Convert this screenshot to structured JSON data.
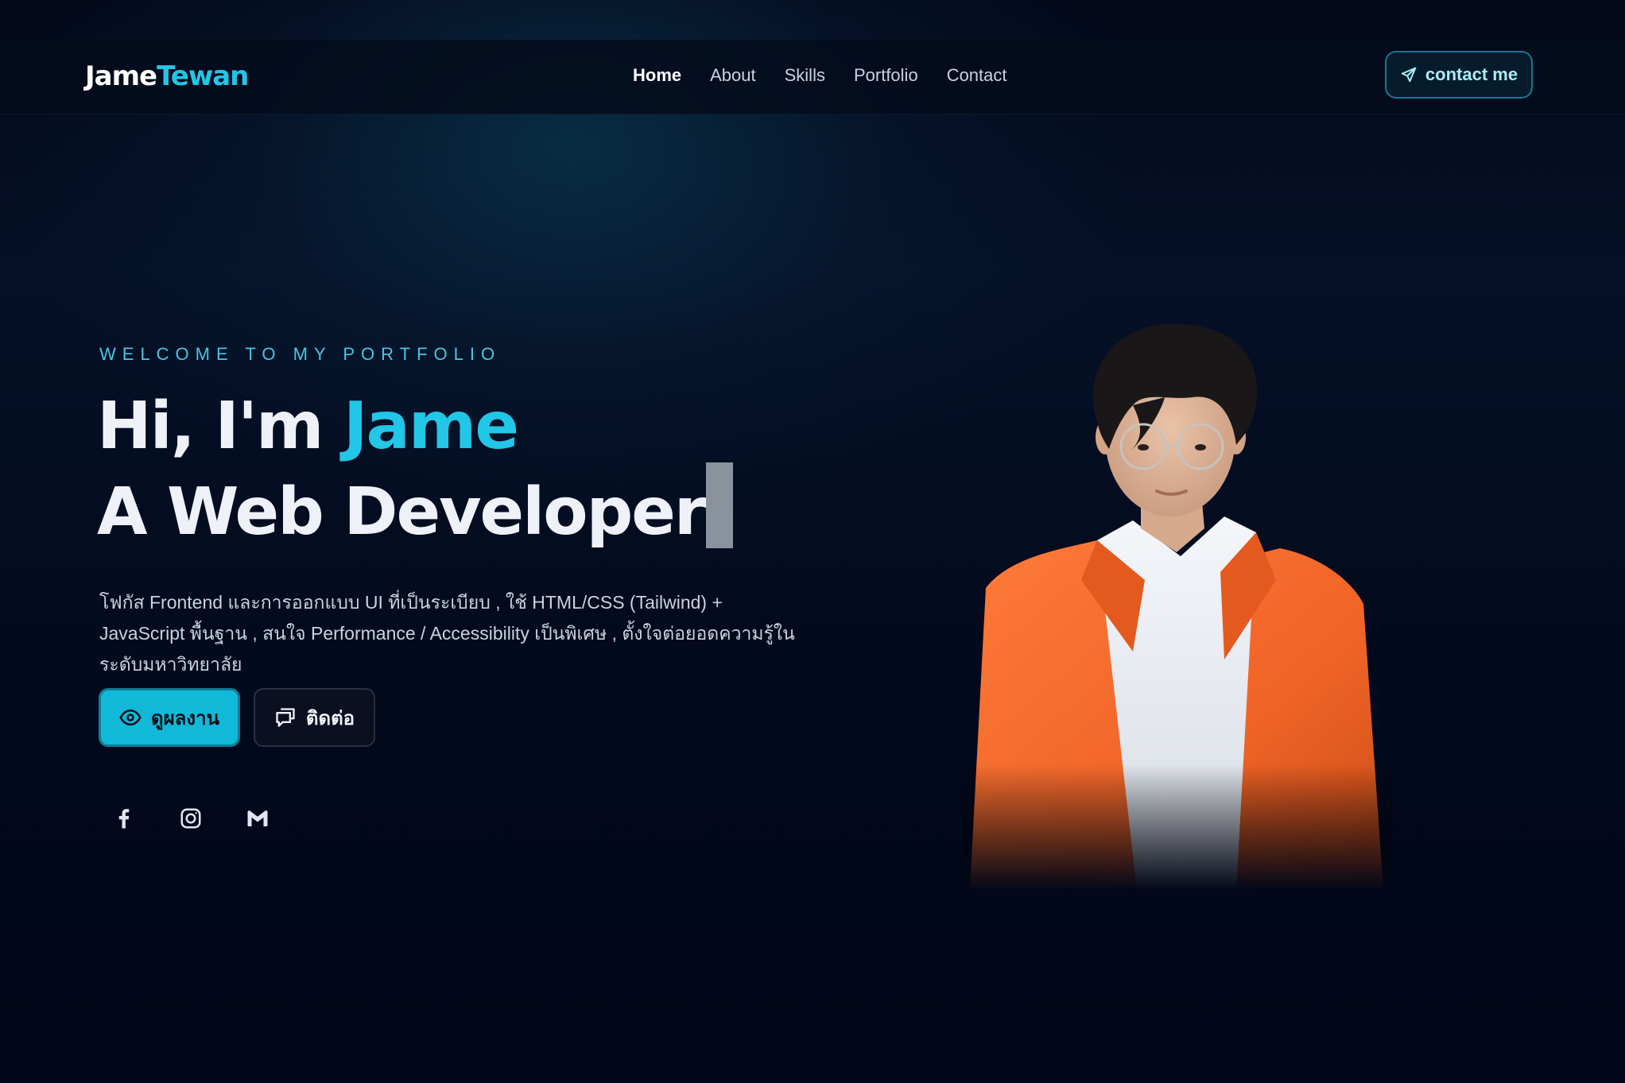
{
  "logo": {
    "part1": "Jame",
    "part2": "Tewan"
  },
  "nav": {
    "items": [
      {
        "label": "Home",
        "active": true
      },
      {
        "label": "About",
        "active": false
      },
      {
        "label": "Skills",
        "active": false
      },
      {
        "label": "Portfolio",
        "active": false
      },
      {
        "label": "Contact",
        "active": false
      }
    ]
  },
  "header": {
    "contact_label": "contact me",
    "contact_icon": "send-icon"
  },
  "hero": {
    "eyebrow": "WELCOME TO MY PORTFOLIO",
    "greeting": "Hi, I'm ",
    "name": "Jame",
    "role": "A Web Developer",
    "description": "โฟกัส Frontend และการออกแบบ UI ที่เป็นระเบียบ , ใช้ HTML/CSS (Tailwind) + JavaScript พื้นฐาน , สนใจ Performance / Accessibility เป็นพิเศษ , ตั้งใจต่อยอดความรู้ในระดับมหาวิทยาลัย",
    "primary_button": "ดูผลงาน",
    "secondary_button": "ติดต่อ"
  },
  "socials": [
    {
      "icon": "facebook-icon"
    },
    {
      "icon": "instagram-icon"
    },
    {
      "icon": "gmail-icon"
    }
  ],
  "colors": {
    "accent": "#22c6e6",
    "background": "#030818",
    "button_primary": "#11b8d8"
  }
}
